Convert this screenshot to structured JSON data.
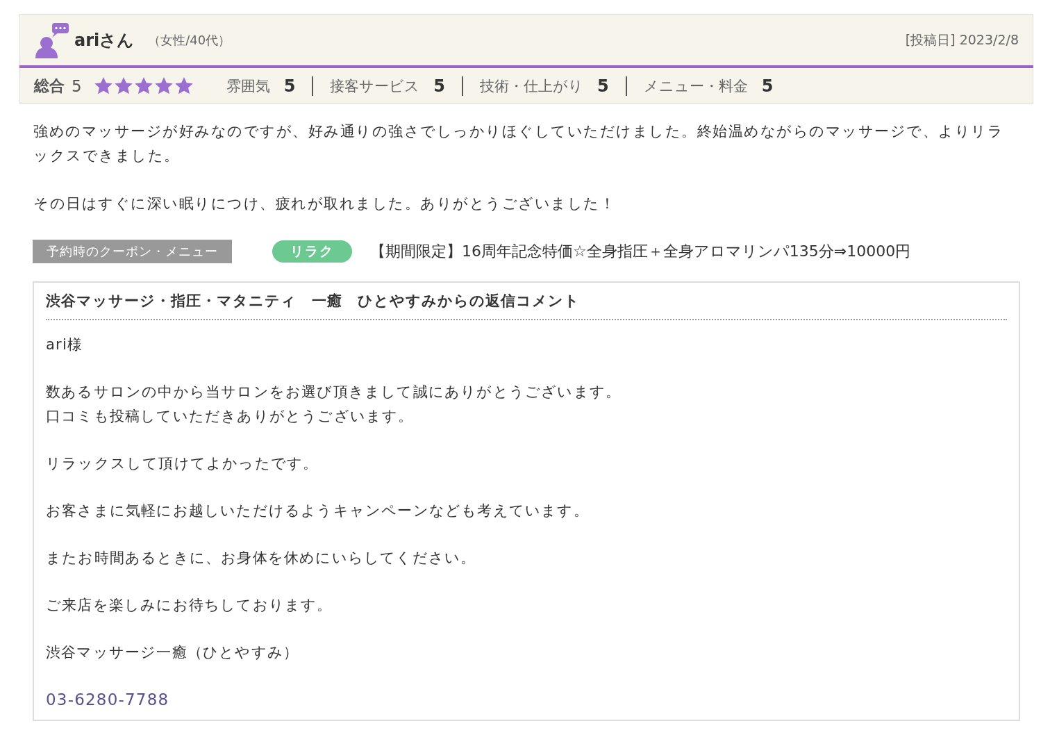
{
  "review": {
    "user": {
      "name": "ariさん",
      "profile": "（女性/40代）"
    },
    "posted": "[投稿日] 2023/2/8",
    "overall": {
      "label": "総合",
      "score": "5",
      "stars": 5
    },
    "ratings": [
      {
        "label": "雰囲気",
        "score": "5"
      },
      {
        "label": "接客サービス",
        "score": "5"
      },
      {
        "label": "技術・仕上がり",
        "score": "5"
      },
      {
        "label": "メニュー・料金",
        "score": "5"
      }
    ],
    "paragraphs": [
      "強めのマッサージが好みなのですが、好み通りの強さでしっかりほぐしていただけました。終始温めながらのマッサージで、よりリラックスできました。",
      "その日はすぐに深い眠りにつけ、疲れが取れました。ありがとうございました！"
    ],
    "coupon": {
      "heading": "予約時のクーポン・メニュー",
      "tag": {
        "label": "リラク",
        "color": "#6cc992"
      },
      "name": "【期間限定】16周年記念特価☆全身指圧＋全身アロマリンパ135分⇒10000円"
    }
  },
  "reply": {
    "title": "渋谷マッサージ・指圧・マタニティ　一癒　ひとやすみからの返信コメント",
    "paragraphs": [
      [
        "ari様"
      ],
      [
        "数あるサロンの中から当サロンをお選び頂きまして誠にありがとうございます。",
        "口コミも投稿していただきありがとうございます。"
      ],
      [
        "リラックスして頂けてよかったです。"
      ],
      [
        "お客さまに気軽にお越しいただけるようキャンペーンなども考えています。"
      ],
      [
        "またお時間あるときに、お身体を休めにいらしてください。"
      ],
      [
        "ご来店を楽しみにお待ちしております。"
      ],
      [
        "渋谷マッサージ一癒（ひとやすみ）"
      ]
    ],
    "phone": "03-6280-7788"
  }
}
